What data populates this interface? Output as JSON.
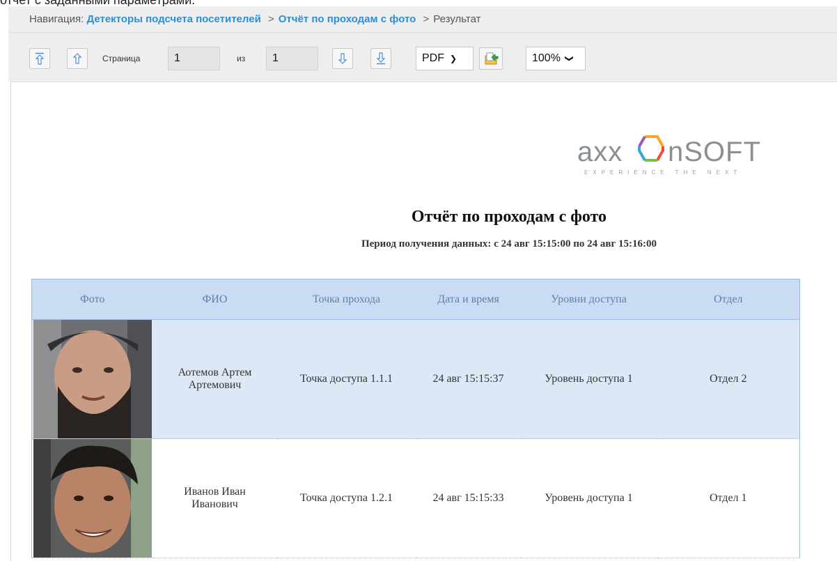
{
  "caption": "отчет с заданными параметрами.",
  "breadcrumb": {
    "prefix": "Навигация:",
    "items": [
      "Детекторы подсчета посетителей",
      "Отчёт по проходам с фото"
    ],
    "current": "Результат",
    "separator": ">"
  },
  "toolbar": {
    "page_label": "Страница",
    "page_value": "1",
    "of_label": "из",
    "total_pages": "1",
    "format_selected": "PDF",
    "zoom_selected": "100%"
  },
  "report": {
    "logo_text": "axxonsoft",
    "logo_tagline": "EXPERIENCE THE NEXT",
    "title": "Отчёт по проходам с фото",
    "period": "Период получения данных: с 24 авг 15:15:00 по 24 авг 15:16:00",
    "columns": [
      "Фото",
      "ФИО",
      "Точка прохода",
      "Дата и время",
      "Уровни доступа",
      "Отдел"
    ],
    "rows": [
      {
        "name_line1": "Аотемов Артем",
        "name_line2": "Артемович",
        "point": "Точка доступа 1.1.1",
        "datetime": "24 авг 15:15:37",
        "access": "Уровень доступа 1",
        "department": "Отдел 2"
      },
      {
        "name_line1": "Иванов Иван",
        "name_line2": "Иванович",
        "point": "Точка доступа 1.2.1",
        "datetime": "24 авг 15:15:33",
        "access": "Уровень доступа 1",
        "department": "Отдел 1"
      }
    ]
  },
  "colors": {
    "link": "#2d8fd5",
    "header_bg": "#c9dcf3",
    "alt_row_bg": "#dde8f6",
    "header_text": "#5f7fa8",
    "border": "#9bbbe3",
    "icon_blue": "#4a8fd6"
  },
  "icons": [
    "first-page-icon",
    "previous-page-icon",
    "next-page-icon",
    "last-page-icon",
    "export-icon",
    "chevron-down-icon"
  ]
}
